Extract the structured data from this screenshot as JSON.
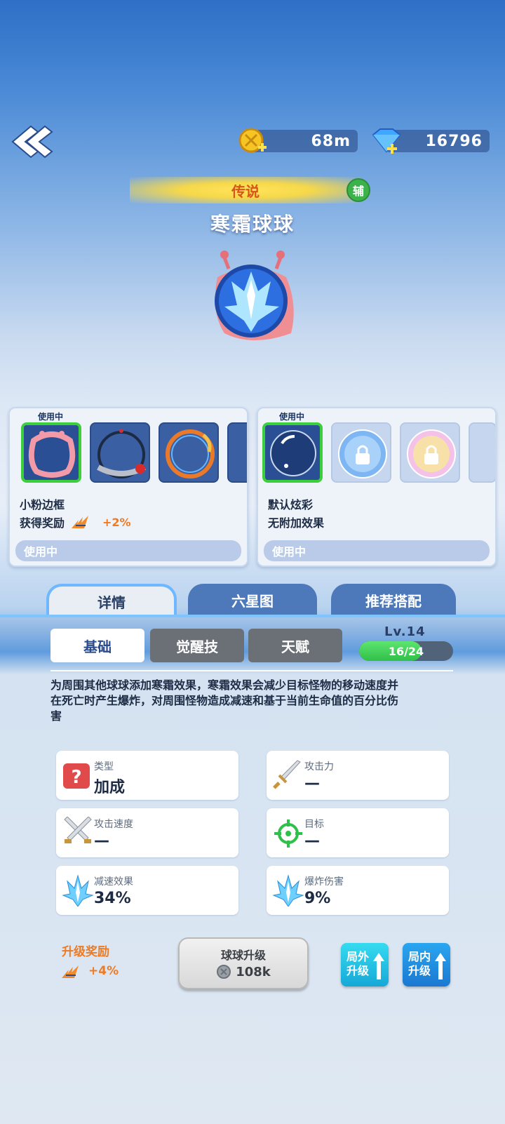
{
  "currency": {
    "gold": "68m",
    "gems": "16796"
  },
  "ball": {
    "rarity": "传说",
    "role_badge": "辅",
    "name": "寒霜球球"
  },
  "skins": {
    "frame": {
      "tag": "使用中",
      "name": "小粉边框",
      "reward_label": "获得奖励",
      "reward_value": "+2%",
      "status": "使用中"
    },
    "effect": {
      "tag": "使用中",
      "name": "默认炫彩",
      "desc": "无附加效果",
      "status": "使用中"
    }
  },
  "tabs": [
    "详情",
    "六星图",
    "推荐搭配"
  ],
  "subtabs": [
    "基础",
    "觉醒技",
    "天赋"
  ],
  "level": {
    "label": "Lv.14",
    "progress_text": "16/24",
    "progress": 0.667
  },
  "description": "为周围其他球球添加寒霜效果，寒霜效果会减少目标怪物的移动速度并在死亡时产生爆炸，对周围怪物造成减速和基于当前生命值的百分比伤害",
  "stats": [
    {
      "label": "类型",
      "value": "加成",
      "icon": "question-icon"
    },
    {
      "label": "攻击力",
      "value": "—",
      "icon": "sword-icon"
    },
    {
      "label": "攻击速度",
      "value": "—",
      "icon": "crossed-swords-icon"
    },
    {
      "label": "目标",
      "value": "—",
      "icon": "target-icon"
    },
    {
      "label": "减速效果",
      "value": "34%",
      "icon": "ice-crystal-icon"
    },
    {
      "label": "爆炸伤害",
      "value": "9%",
      "icon": "ice-crystal-icon"
    }
  ],
  "upgrade_reward": {
    "title": "升级奖励",
    "value": "+4%"
  },
  "upgrade": {
    "title": "球球升级",
    "cost": "108k"
  },
  "side_buttons": [
    {
      "line1": "局外",
      "line2": "升级"
    },
    {
      "line1": "局内",
      "line2": "升级"
    }
  ],
  "colors": {
    "accent_green": "#3ccf3c",
    "orange": "#f07a22",
    "rarity_gold": "#f6d84a"
  }
}
